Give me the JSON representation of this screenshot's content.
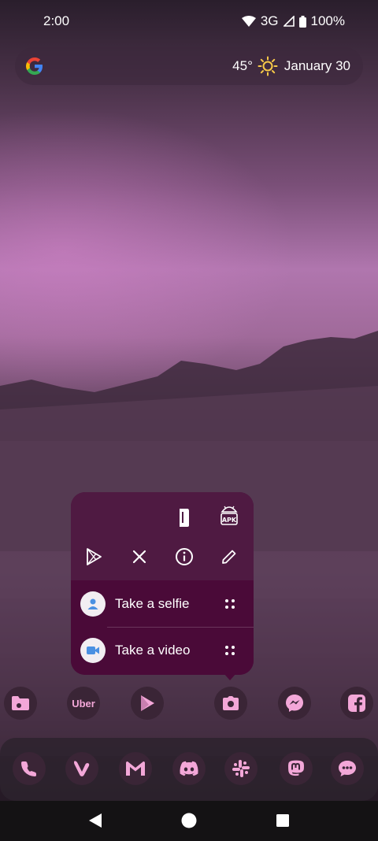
{
  "status_bar": {
    "time": "2:00",
    "network": "3G",
    "battery": "100%"
  },
  "search_widget": {
    "temperature": "45°",
    "weather_icon": "sun-icon",
    "date": "January 30"
  },
  "shortcut_popup": {
    "widgets_row": [
      "wallet-widget-icon",
      "apk-widget-icon"
    ],
    "actions_row": [
      "play-store-icon",
      "close-icon",
      "info-icon",
      "edit-icon"
    ],
    "shortcuts": [
      {
        "label": "Take a selfie",
        "icon": "person-icon"
      },
      {
        "label": "Take a video",
        "icon": "video-camera-icon"
      }
    ]
  },
  "home_row": [
    {
      "name": "files-app-icon"
    },
    {
      "name": "uber-app-icon",
      "text": "Uber"
    },
    {
      "name": "play-store-app-icon"
    },
    {
      "name": "camera-app-icon"
    },
    {
      "name": "messenger-app-icon"
    },
    {
      "name": "facebook-app-icon"
    }
  ],
  "dock_apps": [
    {
      "name": "phone-app-icon"
    },
    {
      "name": "vivaldi-app-icon"
    },
    {
      "name": "gmail-app-icon"
    },
    {
      "name": "discord-app-icon"
    },
    {
      "name": "slack-app-icon"
    },
    {
      "name": "mastodon-app-icon"
    },
    {
      "name": "messages-app-icon"
    }
  ],
  "colors": {
    "popup_bg": "#4a0a38",
    "icon_tint": "#f3a7d8"
  }
}
